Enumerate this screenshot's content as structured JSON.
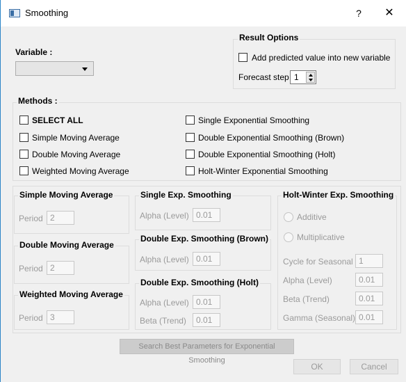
{
  "window": {
    "title": "Smoothing",
    "help": "?",
    "close": "✕"
  },
  "result_options": {
    "title": "Result Options",
    "add_predicted_label": "Add predicted value into new variable",
    "forecast_label": "Forecast step",
    "forecast_value": "1"
  },
  "variable": {
    "label": "Variable :",
    "selected": ""
  },
  "methods": {
    "title": "Methods :",
    "items": [
      "SELECT ALL",
      "Simple Moving Average",
      "Double Moving Average",
      "Weighted Moving Average",
      "Single Exponential Smoothing",
      "Double Exponential Smoothing (Brown)",
      "Double Exponential Smoothing (Holt)",
      "Holt-Winter Exponential Smoothing"
    ]
  },
  "sma": {
    "title": "Simple Moving Average",
    "period_label": "Period",
    "period_value": "2"
  },
  "dma": {
    "title": "Double Moving Average",
    "period_label": "Period",
    "period_value": "2"
  },
  "wma": {
    "title": "Weighted Moving Average",
    "period_label": "Period",
    "period_value": "3"
  },
  "ses": {
    "title": "Single Exp. Smoothing",
    "alpha_label": "Alpha (Level)",
    "alpha_value": "0.01"
  },
  "brown": {
    "title": "Double Exp. Smoothing (Brown)",
    "alpha_label": "Alpha (Level)",
    "alpha_value": "0.01"
  },
  "holt": {
    "title": "Double Exp. Smoothing (Holt)",
    "alpha_label": "Alpha (Level)",
    "alpha_value": "0.01",
    "beta_label": "Beta (Trend)",
    "beta_value": "0.01"
  },
  "hw": {
    "title": "Holt-Winter Exp. Smoothing",
    "additive_label": "Additive",
    "multiplicative_label": "Multiplicative",
    "cycle_label": "Cycle for Seasonal",
    "cycle_value": "1",
    "alpha_label": "Alpha (Level)",
    "alpha_value": "0.01",
    "beta_label": "Beta (Trend)",
    "beta_value": "0.01",
    "gamma_label": "Gamma (Seasonal)",
    "gamma_value": "0.01"
  },
  "buttons": {
    "search_label": "Search Best Parameters for Exponential Smoothing",
    "ok_label": "OK",
    "cancel_label": "Cancel"
  }
}
